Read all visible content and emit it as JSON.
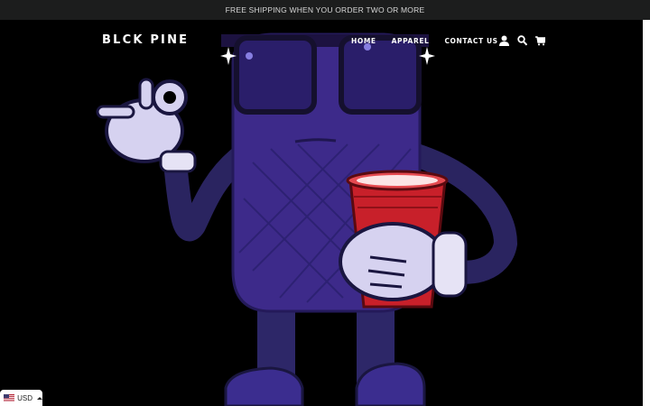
{
  "announcement": {
    "text": "FREE SHIPPING WHEN YOU ORDER TWO OR MORE"
  },
  "header": {
    "logo": "BLCK PINE",
    "nav": [
      {
        "label": "HOME"
      },
      {
        "label": "APPAREL"
      },
      {
        "label": "CONTACT US"
      }
    ],
    "icons": [
      "account-icon",
      "search-icon",
      "cart-icon"
    ]
  },
  "currency": {
    "selected": "USD",
    "flag": "us-flag-icon"
  },
  "colors": {
    "announce_bg": "#1c1d1d",
    "hero_bg": "#000000",
    "character_purple": "#3d2a8a",
    "cup_red": "#c8202a"
  }
}
